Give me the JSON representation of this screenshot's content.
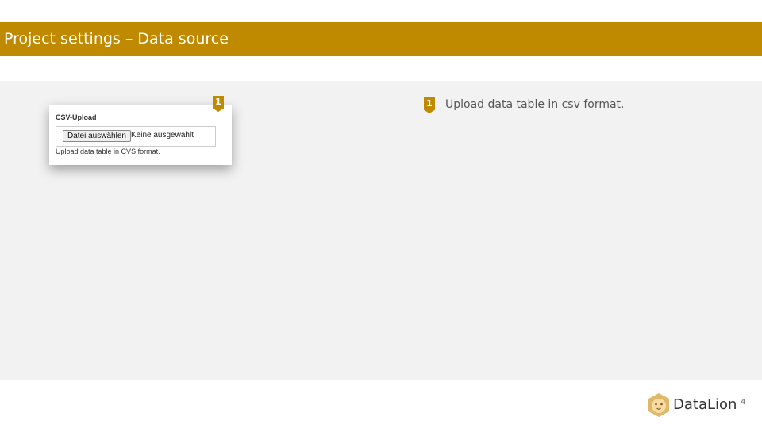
{
  "header": {
    "title": "Project settings – Data source"
  },
  "upload_card": {
    "label": "CSV-Upload",
    "choose_button_label": "Datei auswählen",
    "file_status": "Keine ausgewählt",
    "help_text": "Upload data table in CVS format.",
    "marker": "1"
  },
  "notes": [
    {
      "marker": "1",
      "text": "Upload data table in csv format."
    }
  ],
  "footer": {
    "logo_text": "DataLion",
    "logo_icon": "lion-head-icon",
    "page_number": "4"
  },
  "colors": {
    "accent": "#c08a00",
    "content_background": "#f2f2f2",
    "logo_accent": "#e0b86a"
  }
}
